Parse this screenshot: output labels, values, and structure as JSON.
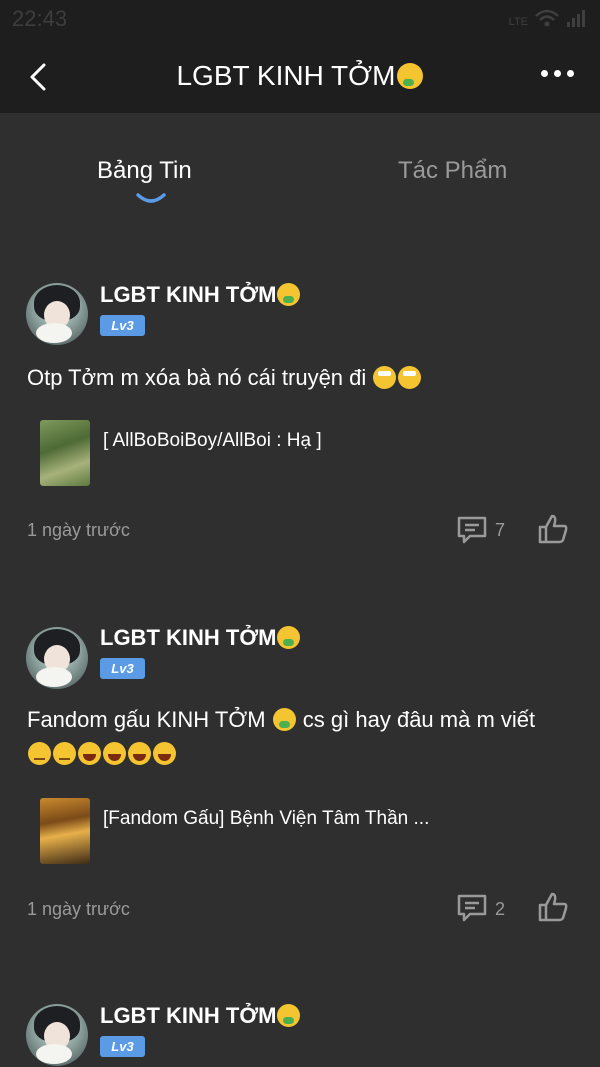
{
  "status": {
    "time": "22:43",
    "network": "LTE"
  },
  "header": {
    "title": "LGBT KINH TỞM",
    "title_emoji": "sick"
  },
  "tabs": [
    {
      "label": "Bảng Tin",
      "active": true
    },
    {
      "label": "Tác Phẩm",
      "active": false
    }
  ],
  "posts": [
    {
      "username": "LGBT KINH TỞM",
      "level": "Lv3",
      "content_text": "Otp Tởm m xóa bà nó cái truyện đi",
      "work_title": "[ AllBoBoiBoy/AllBoi : Hạ ]",
      "time": "1 ngày trước",
      "comment_count": "7"
    },
    {
      "username": "LGBT KINH TỞM",
      "level": "Lv3",
      "content_a": "Fandom gấu KINH TỞM",
      "content_b": "cs gì hay đâu mà m viết",
      "work_title": "[Fandom Gấu] Bệnh Viện Tâm Thần ...",
      "time": "1 ngày trước",
      "comment_count": "2"
    },
    {
      "username": "LGBT KINH TỞM",
      "level": "Lv3"
    }
  ],
  "colors": {
    "background": "#2f2f2f",
    "bar": "#1e1e1e",
    "accent": "#5b9be6",
    "muted": "#9a9a9a"
  }
}
